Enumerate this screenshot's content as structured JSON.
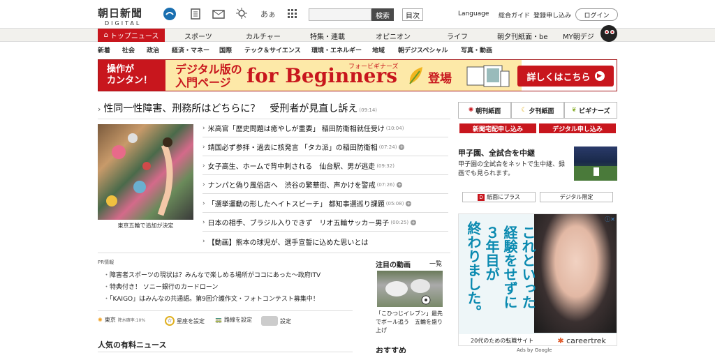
{
  "header": {
    "logo_main": "朝日新聞",
    "logo_sub": "DIGITAL",
    "search_button": "検索",
    "toc_button": "目次",
    "language": "Language",
    "guide": "総合ガイド",
    "register": "登録申し込み",
    "login": "ログイン",
    "icons": [
      "weather-sports-icon",
      "ranking-icon",
      "mail-icon",
      "weather-icon",
      "font-size-icon",
      "grid-menu-icon"
    ],
    "fontsize_label": "あぁ"
  },
  "nav1": [
    "トップニュース",
    "スポーツ",
    "カルチャー",
    "特集・連載",
    "オピニオン",
    "ライフ",
    "朝夕刊紙面・be",
    "MY朝デジ"
  ],
  "nav2": [
    "新着",
    "社会",
    "政治",
    "経済・マネー",
    "国際",
    "テック＆サイエンス",
    "環境・エネルギー",
    "地域",
    "朝デジスペシャル",
    "写真・動画"
  ],
  "banner": {
    "left": "操作が\nカンタン！",
    "line1": "デジタル版の",
    "line2": "入門ページ",
    "big": "for Beginners",
    "small": "フォービギナーズ",
    "tojo": "登場",
    "button": "詳しくはこちら"
  },
  "headline": {
    "text": "性同一性障害、刑務所はどちらに？　受刑者が見直し訴え",
    "time": "(09:14)"
  },
  "photo_caption": "東京五輪で追加が決定",
  "news": [
    {
      "text": "米高官「歴史問題は癒やしが重要」 稲田防衛相就任受け",
      "time": "(10:04)"
    },
    {
      "text": "靖国必ず参拝・過去に核発言 「タカ派」の稲田防衛相",
      "time": "(07:24)"
    },
    {
      "text": "女子高生、ホームで背中刺される　仙台駅、男が逃走",
      "time": "(09:32)"
    },
    {
      "text": "ナンパと偽り風俗店へ　渋谷の繁華街、声かけを警戒",
      "time": "(07:26)"
    },
    {
      "text": "「選挙運動の形したヘイトスピーチ」 都知事選巡り課題",
      "time": "(05:08)"
    },
    {
      "text": "日本の相手、ブラジル入りできず　リオ五輪サッカー男子",
      "time": "(00:25)"
    },
    {
      "text": "【動画】熊本の球児が、選手宣誓に込めた思いとは",
      "time": ""
    }
  ],
  "pr": {
    "label": "PR情報",
    "items": [
      "障害者スポーツの現状は？みんなで楽しめる場所がココにあった〜政府ITV",
      "特典付き！ ソニー銀行のカードローン",
      "「KAIGO」はみんなの共通語。第9回介護作文・フォトコンテスト募集中！"
    ]
  },
  "utility": {
    "city": "東京",
    "weather": "降水確率:10%",
    "star": "星座を設定",
    "route": "路線を設定",
    "settings": "設定"
  },
  "paid_news_title": "人気の有料ニュース",
  "video": {
    "title": "注目の動画",
    "more": "一覧",
    "caption": "「こひつじイレブン」最先でボール追う　五輪を盛り上げ"
  },
  "recommend": "おすすめ",
  "right": {
    "buttons": [
      "朝刊紙面",
      "夕刊紙面",
      "ビギナーズ"
    ],
    "red_buttons": [
      "新聞宅配申し込み",
      "デジタル申し込み"
    ],
    "koshien_title": "甲子園、全試合を中継",
    "koshien_desc": "甲子園の全試合をネットで生中継、録画でも見られます。",
    "gbuttons": [
      "紙面にプラス",
      "デジタル限定"
    ]
  },
  "ad": {
    "col1": "終わりました。",
    "col2": "３年目が",
    "col3": "経験をせずに",
    "col4": "これといった",
    "footer_left": "20代のための転職サイト",
    "footer_right": "careertrek",
    "ads_by": "Ads by Google"
  }
}
